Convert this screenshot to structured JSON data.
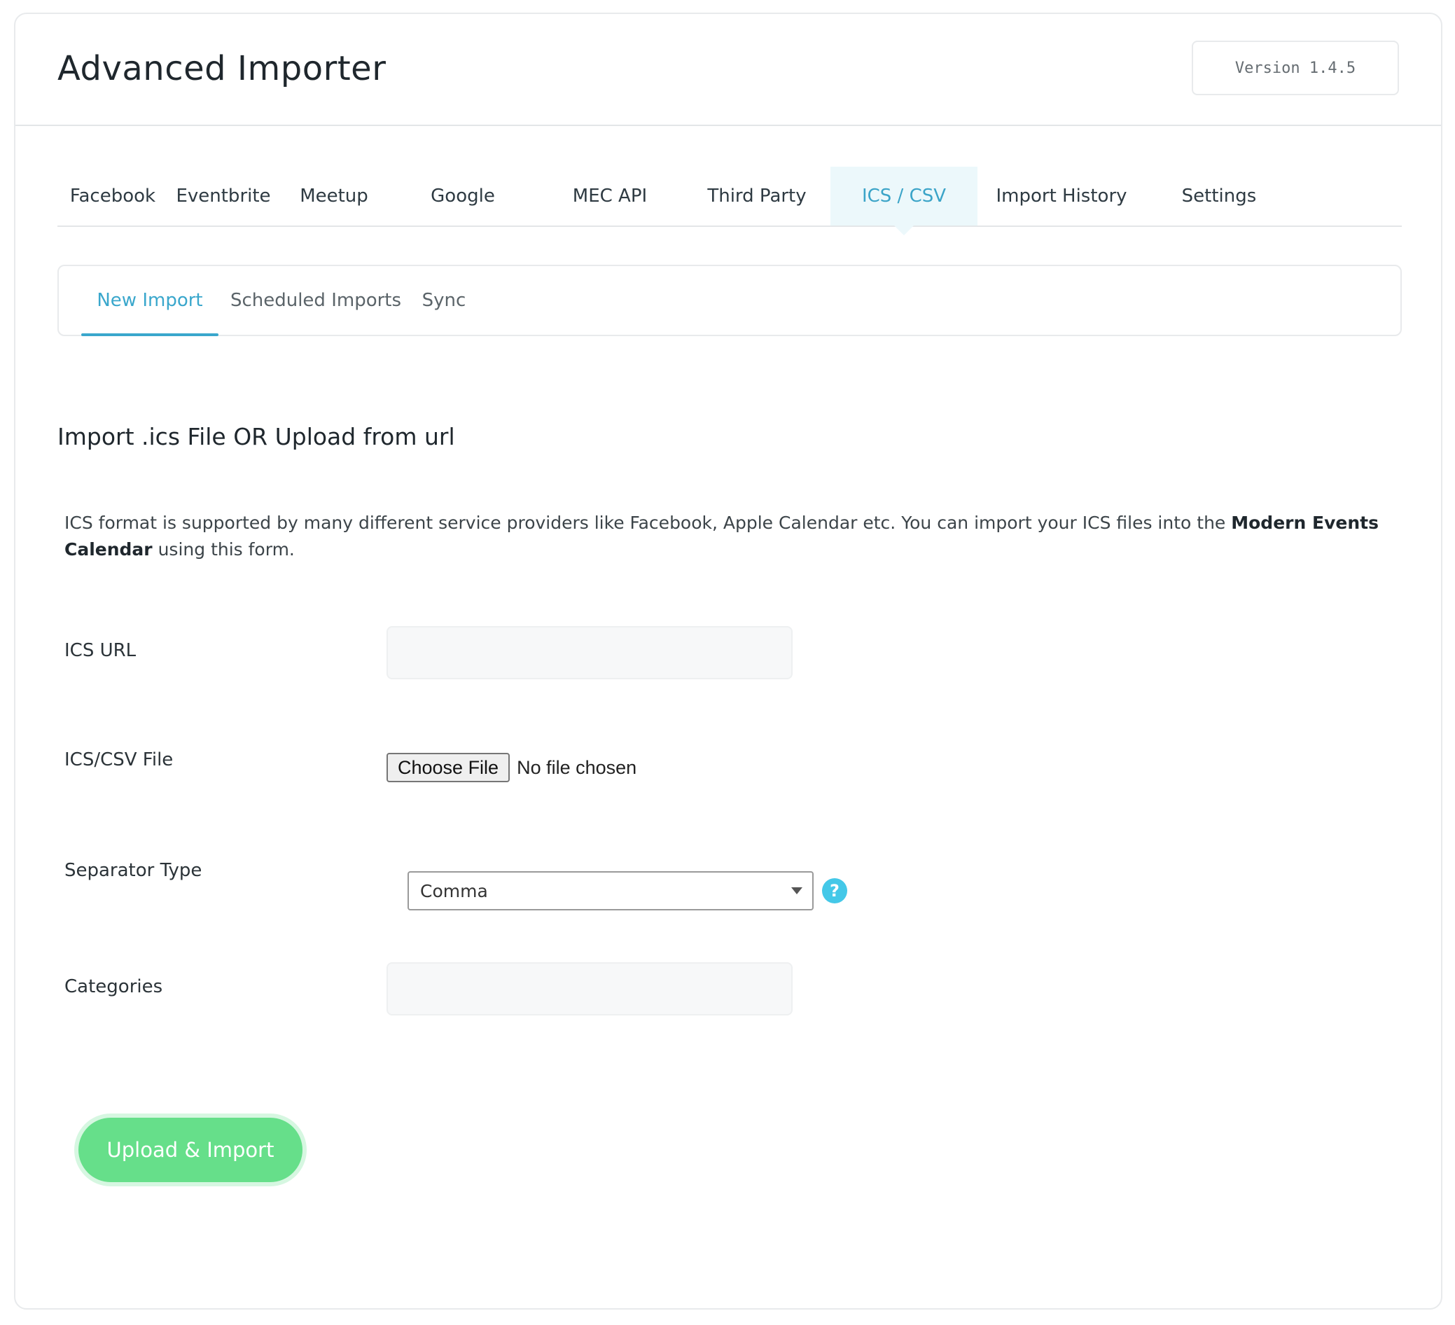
{
  "app": {
    "title": "Advanced Importer",
    "version": "Version 1.4.5"
  },
  "tabs": [
    {
      "label": "Facebook"
    },
    {
      "label": "Eventbrite"
    },
    {
      "label": "Meetup"
    },
    {
      "label": "Google"
    },
    {
      "label": "MEC API"
    },
    {
      "label": "Third Party"
    },
    {
      "label": "ICS / CSV",
      "active": true
    },
    {
      "label": "Import History"
    },
    {
      "label": "Settings"
    }
  ],
  "subtabs": [
    {
      "label": "New Import",
      "active": true
    },
    {
      "label": "Scheduled Imports"
    },
    {
      "label": "Sync"
    }
  ],
  "section": {
    "title": "Import .ics File OR Upload from url",
    "description_before": "ICS format is supported by many different service providers like Facebook, Apple Calendar etc. You can import your ICS files into the ",
    "description_bold": "Modern Events Calendar",
    "description_after": " using this form."
  },
  "form": {
    "ics_url": {
      "label": "ICS URL",
      "value": ""
    },
    "file": {
      "label": "ICS/CSV File",
      "button": "Choose File",
      "status": "No file chosen"
    },
    "separator": {
      "label": "Separator Type",
      "selected": "Comma",
      "help": "?"
    },
    "categories": {
      "label": "Categories",
      "value": ""
    },
    "submit_label": "Upload & Import"
  },
  "colors": {
    "accent": "#3aa7cc",
    "active_tab_bg": "#ecf8fb",
    "submit": "#66df8a",
    "help": "#44c8e8"
  }
}
